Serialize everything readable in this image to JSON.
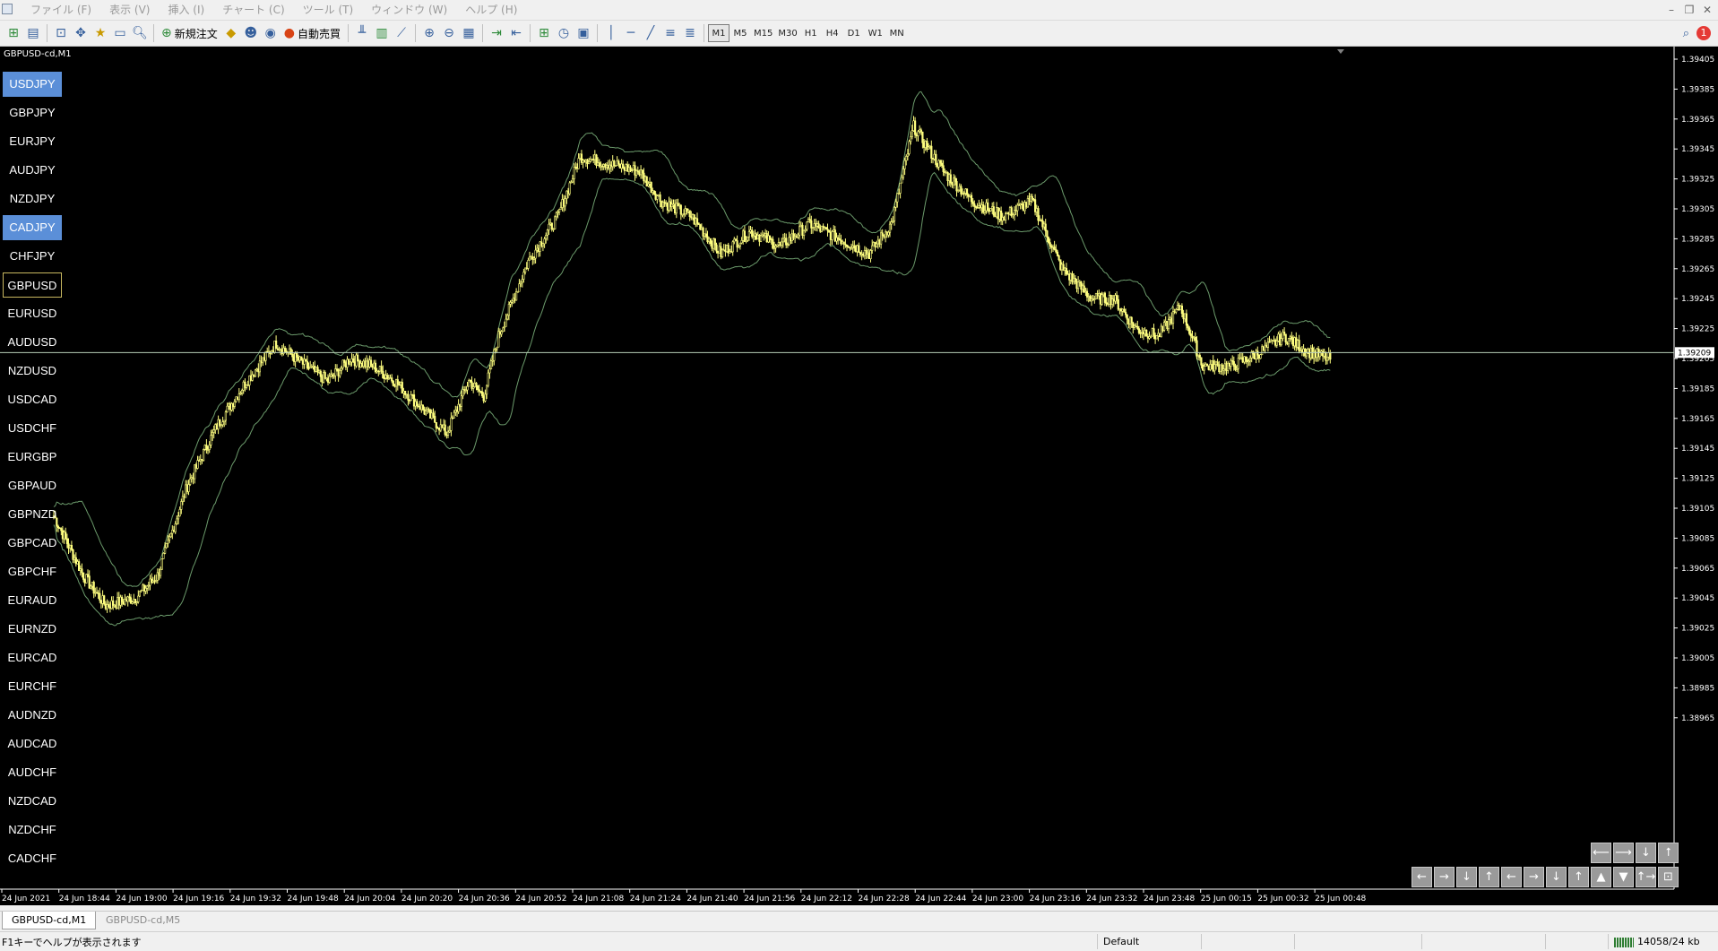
{
  "menu": {
    "items": [
      "ファイル (F)",
      "表示 (V)",
      "挿入 (I)",
      "チャート (C)",
      "ツール (T)",
      "ウィンドウ (W)",
      "ヘルプ (H)"
    ]
  },
  "toolbar": {
    "new_order_label": "新規注文",
    "auto_trading_label": "自動売買",
    "timeframes": [
      "M1",
      "M5",
      "M15",
      "M30",
      "H1",
      "H4",
      "D1",
      "W1",
      "MN"
    ],
    "active_timeframe": "M1",
    "notification_count": "1"
  },
  "chart": {
    "title": "GBPUSD-cd,M1",
    "current_price": "1.39209",
    "background_color": "#000000",
    "candle_color": "#ffff80",
    "band_color": "#6b9a6b",
    "price_axis_labels": [
      "1.39405",
      "1.39385",
      "1.39365",
      "1.39345",
      "1.39325",
      "1.39305",
      "1.39285",
      "1.39265",
      "1.39245",
      "1.39225",
      "1.39205",
      "1.39185",
      "1.39165",
      "1.39145",
      "1.39125",
      "1.39105",
      "1.39085",
      "1.39065",
      "1.39045",
      "1.39025",
      "1.39005",
      "1.38985",
      "1.38965"
    ],
    "time_axis_labels": [
      "24 Jun 2021",
      "24 Jun 18:44",
      "24 Jun 19:00",
      "24 Jun 19:16",
      "24 Jun 19:32",
      "24 Jun 19:48",
      "24 Jun 20:04",
      "24 Jun 20:20",
      "24 Jun 20:36",
      "24 Jun 20:52",
      "24 Jun 21:08",
      "24 Jun 21:24",
      "24 Jun 21:40",
      "24 Jun 21:56",
      "24 Jun 22:12",
      "24 Jun 22:28",
      "24 Jun 22:44",
      "24 Jun 23:00",
      "24 Jun 23:16",
      "24 Jun 23:32",
      "24 Jun 23:48",
      "25 Jun 00:15",
      "25 Jun 00:32",
      "25 Jun 00:48"
    ]
  },
  "symbols": [
    {
      "name": "USDJPY",
      "state": "blue"
    },
    {
      "name": "GBPJPY",
      "state": "normal"
    },
    {
      "name": "EURJPY",
      "state": "normal"
    },
    {
      "name": "AUDJPY",
      "state": "normal"
    },
    {
      "name": "NZDJPY",
      "state": "normal"
    },
    {
      "name": "CADJPY",
      "state": "blue"
    },
    {
      "name": "CHFJPY",
      "state": "normal"
    },
    {
      "name": "GBPUSD",
      "state": "outlined"
    },
    {
      "name": "EURUSD",
      "state": "normal"
    },
    {
      "name": "AUDUSD",
      "state": "normal"
    },
    {
      "name": "NZDUSD",
      "state": "normal"
    },
    {
      "name": "USDCAD",
      "state": "normal"
    },
    {
      "name": "USDCHF",
      "state": "normal"
    },
    {
      "name": "EURGBP",
      "state": "normal"
    },
    {
      "name": "GBPAUD",
      "state": "normal"
    },
    {
      "name": "GBPNZD",
      "state": "normal"
    },
    {
      "name": "GBPCAD",
      "state": "normal"
    },
    {
      "name": "GBPCHF",
      "state": "normal"
    },
    {
      "name": "EURAUD",
      "state": "normal"
    },
    {
      "name": "EURNZD",
      "state": "normal"
    },
    {
      "name": "EURCAD",
      "state": "normal"
    },
    {
      "name": "EURCHF",
      "state": "normal"
    },
    {
      "name": "AUDNZD",
      "state": "normal"
    },
    {
      "name": "AUDCAD",
      "state": "normal"
    },
    {
      "name": "AUDCHF",
      "state": "normal"
    },
    {
      "name": "NZDCAD",
      "state": "normal"
    },
    {
      "name": "NZDCHF",
      "state": "normal"
    },
    {
      "name": "CADCHF",
      "state": "normal"
    }
  ],
  "nav_buttons": {
    "row1": [
      "⟵",
      "⟶",
      "↓",
      "⭡"
    ],
    "row2": [
      "←",
      "→",
      "↓",
      "↑",
      "←",
      "→",
      "↓",
      "↑",
      "▲",
      "▼",
      "↑→",
      "⊡"
    ]
  },
  "tabs": [
    "GBPUSD-cd,M1",
    "GBPUSD-cd,M5"
  ],
  "status": {
    "help": "F1キーでヘルプが表示されます",
    "profile": "Default",
    "traffic": "14058/24 kb"
  }
}
